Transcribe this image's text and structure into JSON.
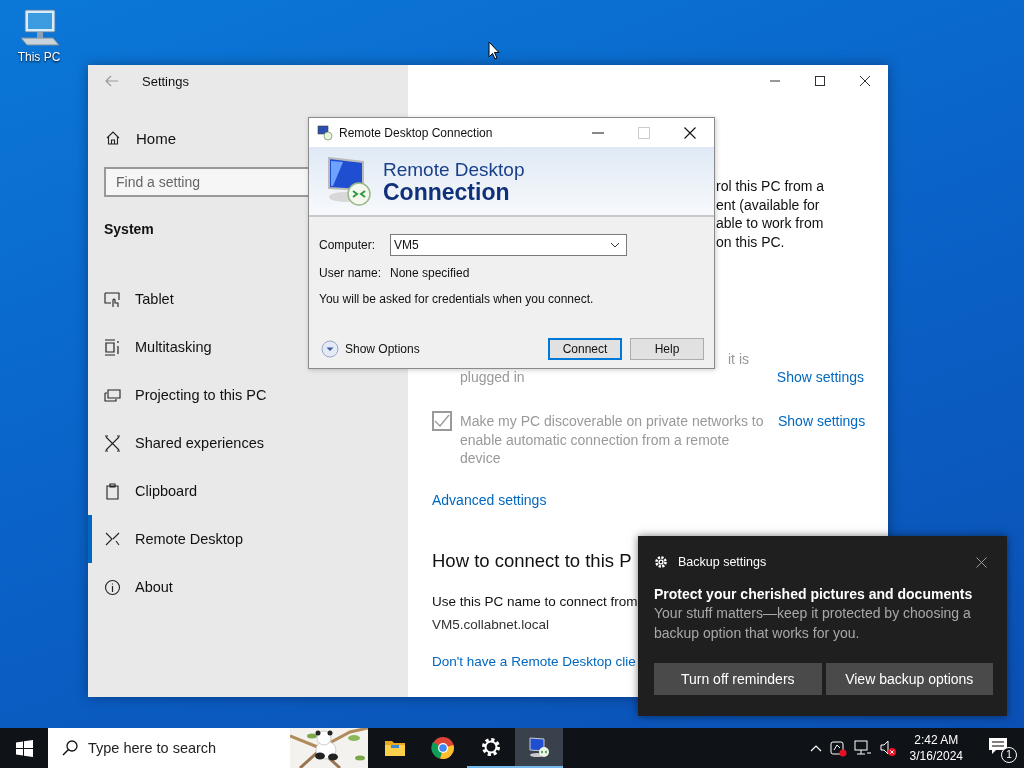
{
  "desktop_icons": [
    {
      "label": "This PC"
    }
  ],
  "settings_window": {
    "title": "Settings",
    "sidebar": {
      "home": "Home",
      "search": {
        "placeholder": "Find a setting"
      },
      "section": "System",
      "items": [
        {
          "label": "Tablet",
          "selected": false
        },
        {
          "label": "Multitasking",
          "selected": false
        },
        {
          "label": "Projecting to this PC",
          "selected": false
        },
        {
          "label": "Shared experiences",
          "selected": false
        },
        {
          "label": "Clipboard",
          "selected": false
        },
        {
          "label": "Remote Desktop",
          "selected": true
        },
        {
          "label": "About",
          "selected": false
        }
      ]
    },
    "content": {
      "description_lines": [
        "rol this PC from a",
        "ent (available for",
        "able to work from",
        "on this PC."
      ],
      "power_option": {
        "line_1_fragment": "it is",
        "line_2": "plugged in",
        "link": "Show settings"
      },
      "discoverable_option": {
        "checked": true,
        "disabled": true,
        "label": "Make my PC discoverable on private networks to enable automatic connection from a remote device",
        "link": "Show settings"
      },
      "advanced_link": "Advanced settings",
      "heading": "How to connect to this P",
      "pc_name_label": "Use this PC name to connect from",
      "pc_name": "VM5.collabnet.local",
      "client_link": "Don't have a Remote Desktop clie"
    }
  },
  "rdc_dialog": {
    "title": "Remote Desktop Connection",
    "controls": [
      {
        "kind": "minimize",
        "disabled": false
      },
      {
        "kind": "maximize",
        "disabled": true
      },
      {
        "kind": "close",
        "disabled": false
      }
    ],
    "banner_line_1": "Remote Desktop",
    "banner_line_2": "Connection",
    "computer_label": "Computer:",
    "computer_value": "VM5",
    "user_label": "User name:",
    "user_value": "None specified",
    "message": "You will be asked for credentials when you connect.",
    "show_options": "Show Options",
    "buttons": [
      {
        "label": "Connect",
        "default": true
      },
      {
        "label": "Help",
        "default": false
      }
    ]
  },
  "notification": {
    "app": "Backup settings",
    "title": "Protect your cherished pictures and documents",
    "body": "Your stuff matters—keep it protected by choosing a backup option that works for you.",
    "buttons": [
      "Turn off reminders",
      "View backup options"
    ]
  },
  "taskbar": {
    "search": {
      "placeholder": "Type here to search"
    },
    "apps": [
      {
        "kind": "explorer",
        "running": false,
        "active": false
      },
      {
        "kind": "chrome",
        "running": false,
        "active": false
      },
      {
        "kind": "settings",
        "running": true,
        "active": false
      },
      {
        "kind": "rdc",
        "running": true,
        "active": true
      }
    ],
    "clock": {
      "time": "2:42 AM",
      "date": "3/16/2024"
    },
    "notification_count": "1"
  }
}
